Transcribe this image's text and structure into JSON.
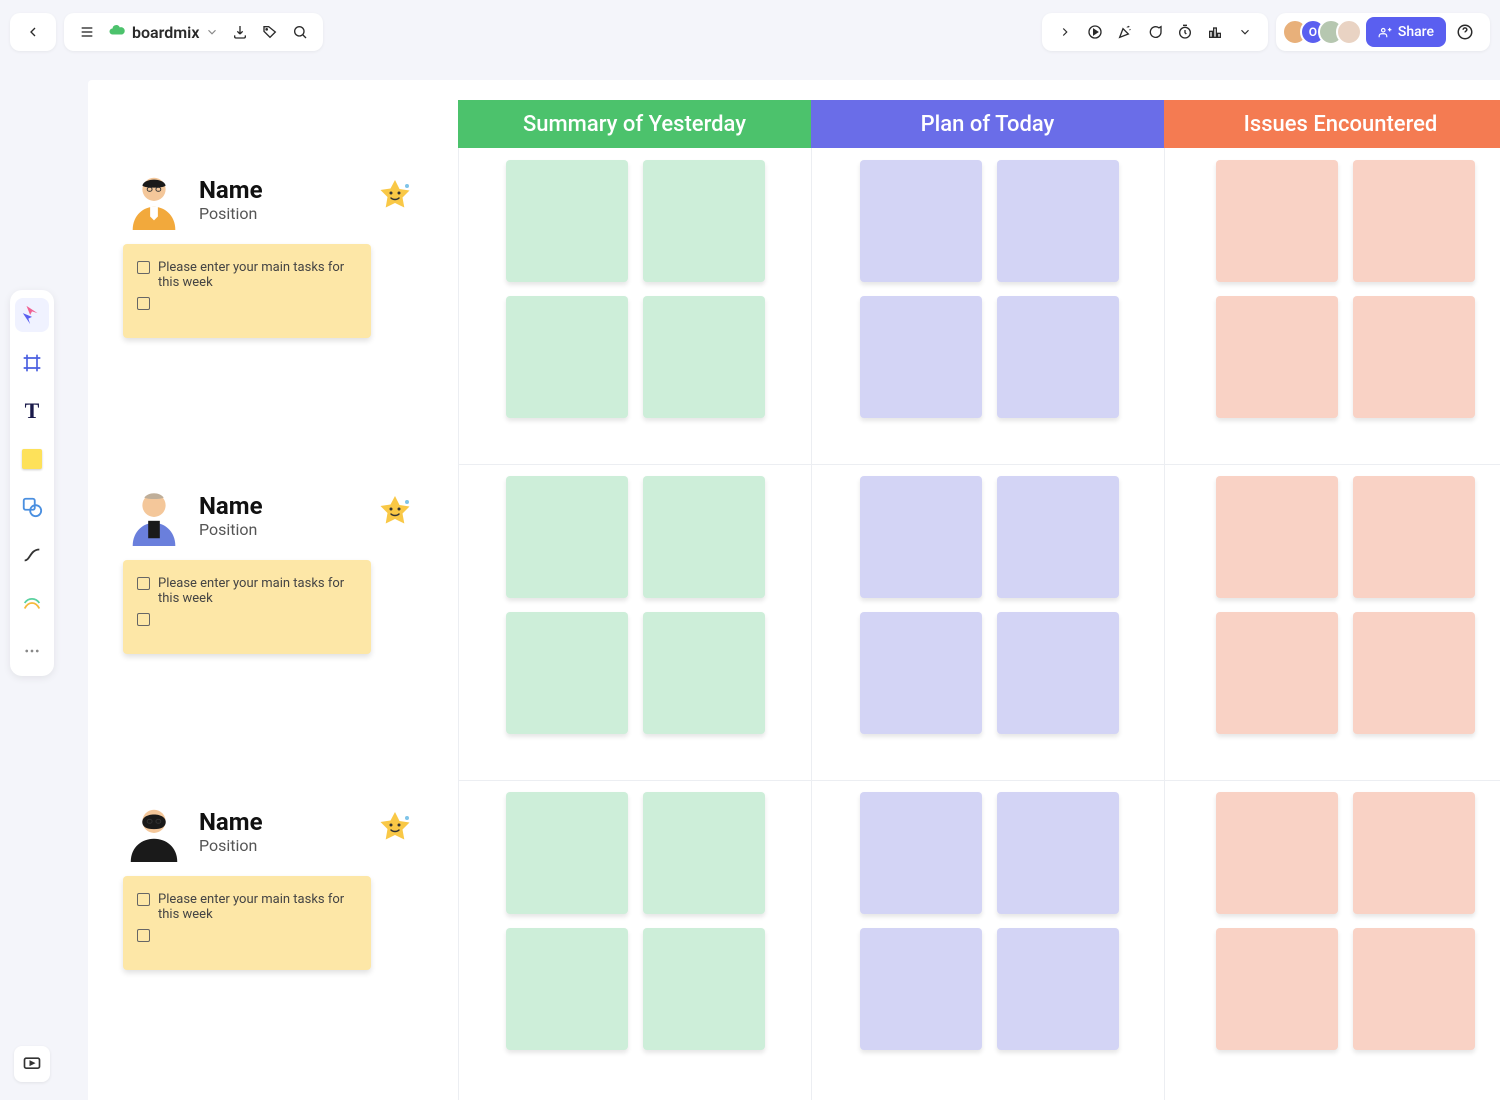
{
  "app": {
    "name": "boardmix"
  },
  "toolbar": {
    "share_label": "Share"
  },
  "avatars": [
    {
      "bg": "#e8b07a"
    },
    {
      "bg": "#5a5ff0",
      "letter": "O"
    },
    {
      "bg": "#b6c7b0"
    },
    {
      "bg": "#e9d3c3"
    }
  ],
  "side_tools": [
    {
      "name": "select-tool"
    },
    {
      "name": "frame-tool"
    },
    {
      "name": "text-tool"
    },
    {
      "name": "sticky-note-tool"
    },
    {
      "name": "shape-tool"
    },
    {
      "name": "connector-tool"
    },
    {
      "name": "highlighter-tool"
    },
    {
      "name": "more-tools"
    }
  ],
  "columns": [
    {
      "label": "Summary of Yesterday",
      "color": "#4cc26c",
      "note_color": "s-green"
    },
    {
      "label": "Plan of Today",
      "color": "#6a6de8",
      "note_color": "s-purple"
    },
    {
      "label": "Issues Encountered",
      "color": "#f47b52",
      "note_color": "s-orange"
    }
  ],
  "rows": [
    {
      "name": "Name",
      "position": "Position",
      "task_placeholder": "Please enter your main tasks for this week",
      "avatar_colors": {
        "shirt": "#f2a93c",
        "hair": "#1a1a1a"
      }
    },
    {
      "name": "Name",
      "position": "Position",
      "task_placeholder": "Please enter your main tasks for this week",
      "avatar_colors": {
        "shirt": "#6a7fdc",
        "hair": "#6b5a4a"
      }
    },
    {
      "name": "Name",
      "position": "Position",
      "task_placeholder": "Please enter your main tasks for this week",
      "avatar_colors": {
        "shirt": "#1a1a1a",
        "hair": "#1a1a1a"
      }
    }
  ]
}
